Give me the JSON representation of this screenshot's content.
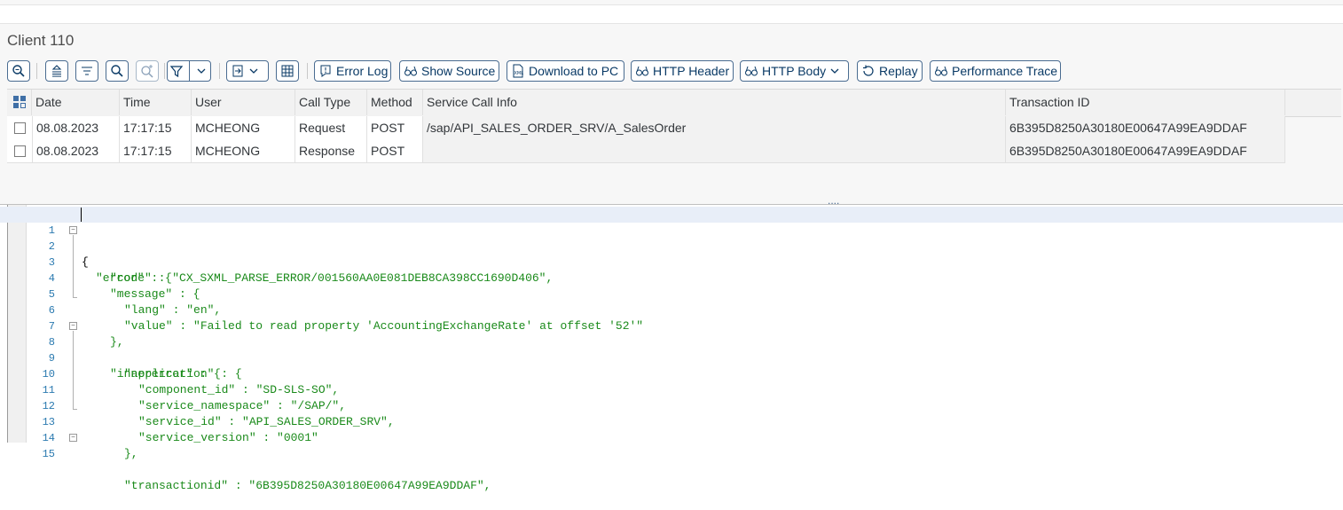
{
  "client_title": "Client 110",
  "toolbar": {
    "error_log": "Error Log",
    "show_source": "Show Source",
    "download": "Download to PC",
    "http_header": "HTTP Header",
    "http_body": "HTTP Body",
    "replay": "Replay",
    "performance_trace": "Performance Trace"
  },
  "grid": {
    "columns": [
      "Date",
      "Time",
      "User",
      "Call Type",
      "Method",
      "Service Call Info",
      "Transaction ID"
    ],
    "rows": [
      {
        "date": "08.08.2023",
        "time": "17:17:15",
        "user": "MCHEONG",
        "call_type": "Request",
        "method": "POST",
        "service_call_info": "/sap/API_SALES_ORDER_SRV/A_SalesOrder",
        "transaction_id": "6B395D8250A30180E00647A99EA9DDAF"
      },
      {
        "date": "08.08.2023",
        "time": "17:17:15",
        "user": "MCHEONG",
        "call_type": "Response",
        "method": "POST",
        "service_call_info": "",
        "transaction_id": "6B395D8250A30180E00647A99EA9DDAF"
      }
    ]
  },
  "splitter_label": "....",
  "editor": {
    "lines": [
      {
        "num": "1",
        "text": "{"
      },
      {
        "num": "2",
        "text": "\"error\" : {"
      },
      {
        "num": "3",
        "text": "\"code\" : \"CX_SXML_PARSE_ERROR/001560AA0E081DEB8CA398CC1690D406\","
      },
      {
        "num": "4",
        "text": "\"message\" : {"
      },
      {
        "num": "5",
        "text": "\"lang\" : \"en\","
      },
      {
        "num": "6",
        "text": "\"value\" : \"Failed to read property 'AccountingExchangeRate' at offset '52'\""
      },
      {
        "num": "7",
        "text": "},"
      },
      {
        "num": "8",
        "text": "\"innererror\" : {"
      },
      {
        "num": "9",
        "text": "\"application\" : {"
      },
      {
        "num": "10",
        "text": "\"component_id\" : \"SD-SLS-SO\","
      },
      {
        "num": "11",
        "text": "\"service_namespace\" : \"/SAP/\","
      },
      {
        "num": "12",
        "text": "\"service_id\" : \"API_SALES_ORDER_SRV\","
      },
      {
        "num": "13",
        "text": "\"service_version\" : \"0001\""
      },
      {
        "num": "14",
        "text": "},"
      },
      {
        "num": "15",
        "text": "\"transactionid\" : \"6B395D8250A30180E00647A99EA9DDAF\","
      }
    ]
  },
  "colors": {
    "accent": "#0a3a66",
    "border": "#4a6c91",
    "code_green": "#1a8a1a",
    "line_number": "#2b7ab0"
  }
}
